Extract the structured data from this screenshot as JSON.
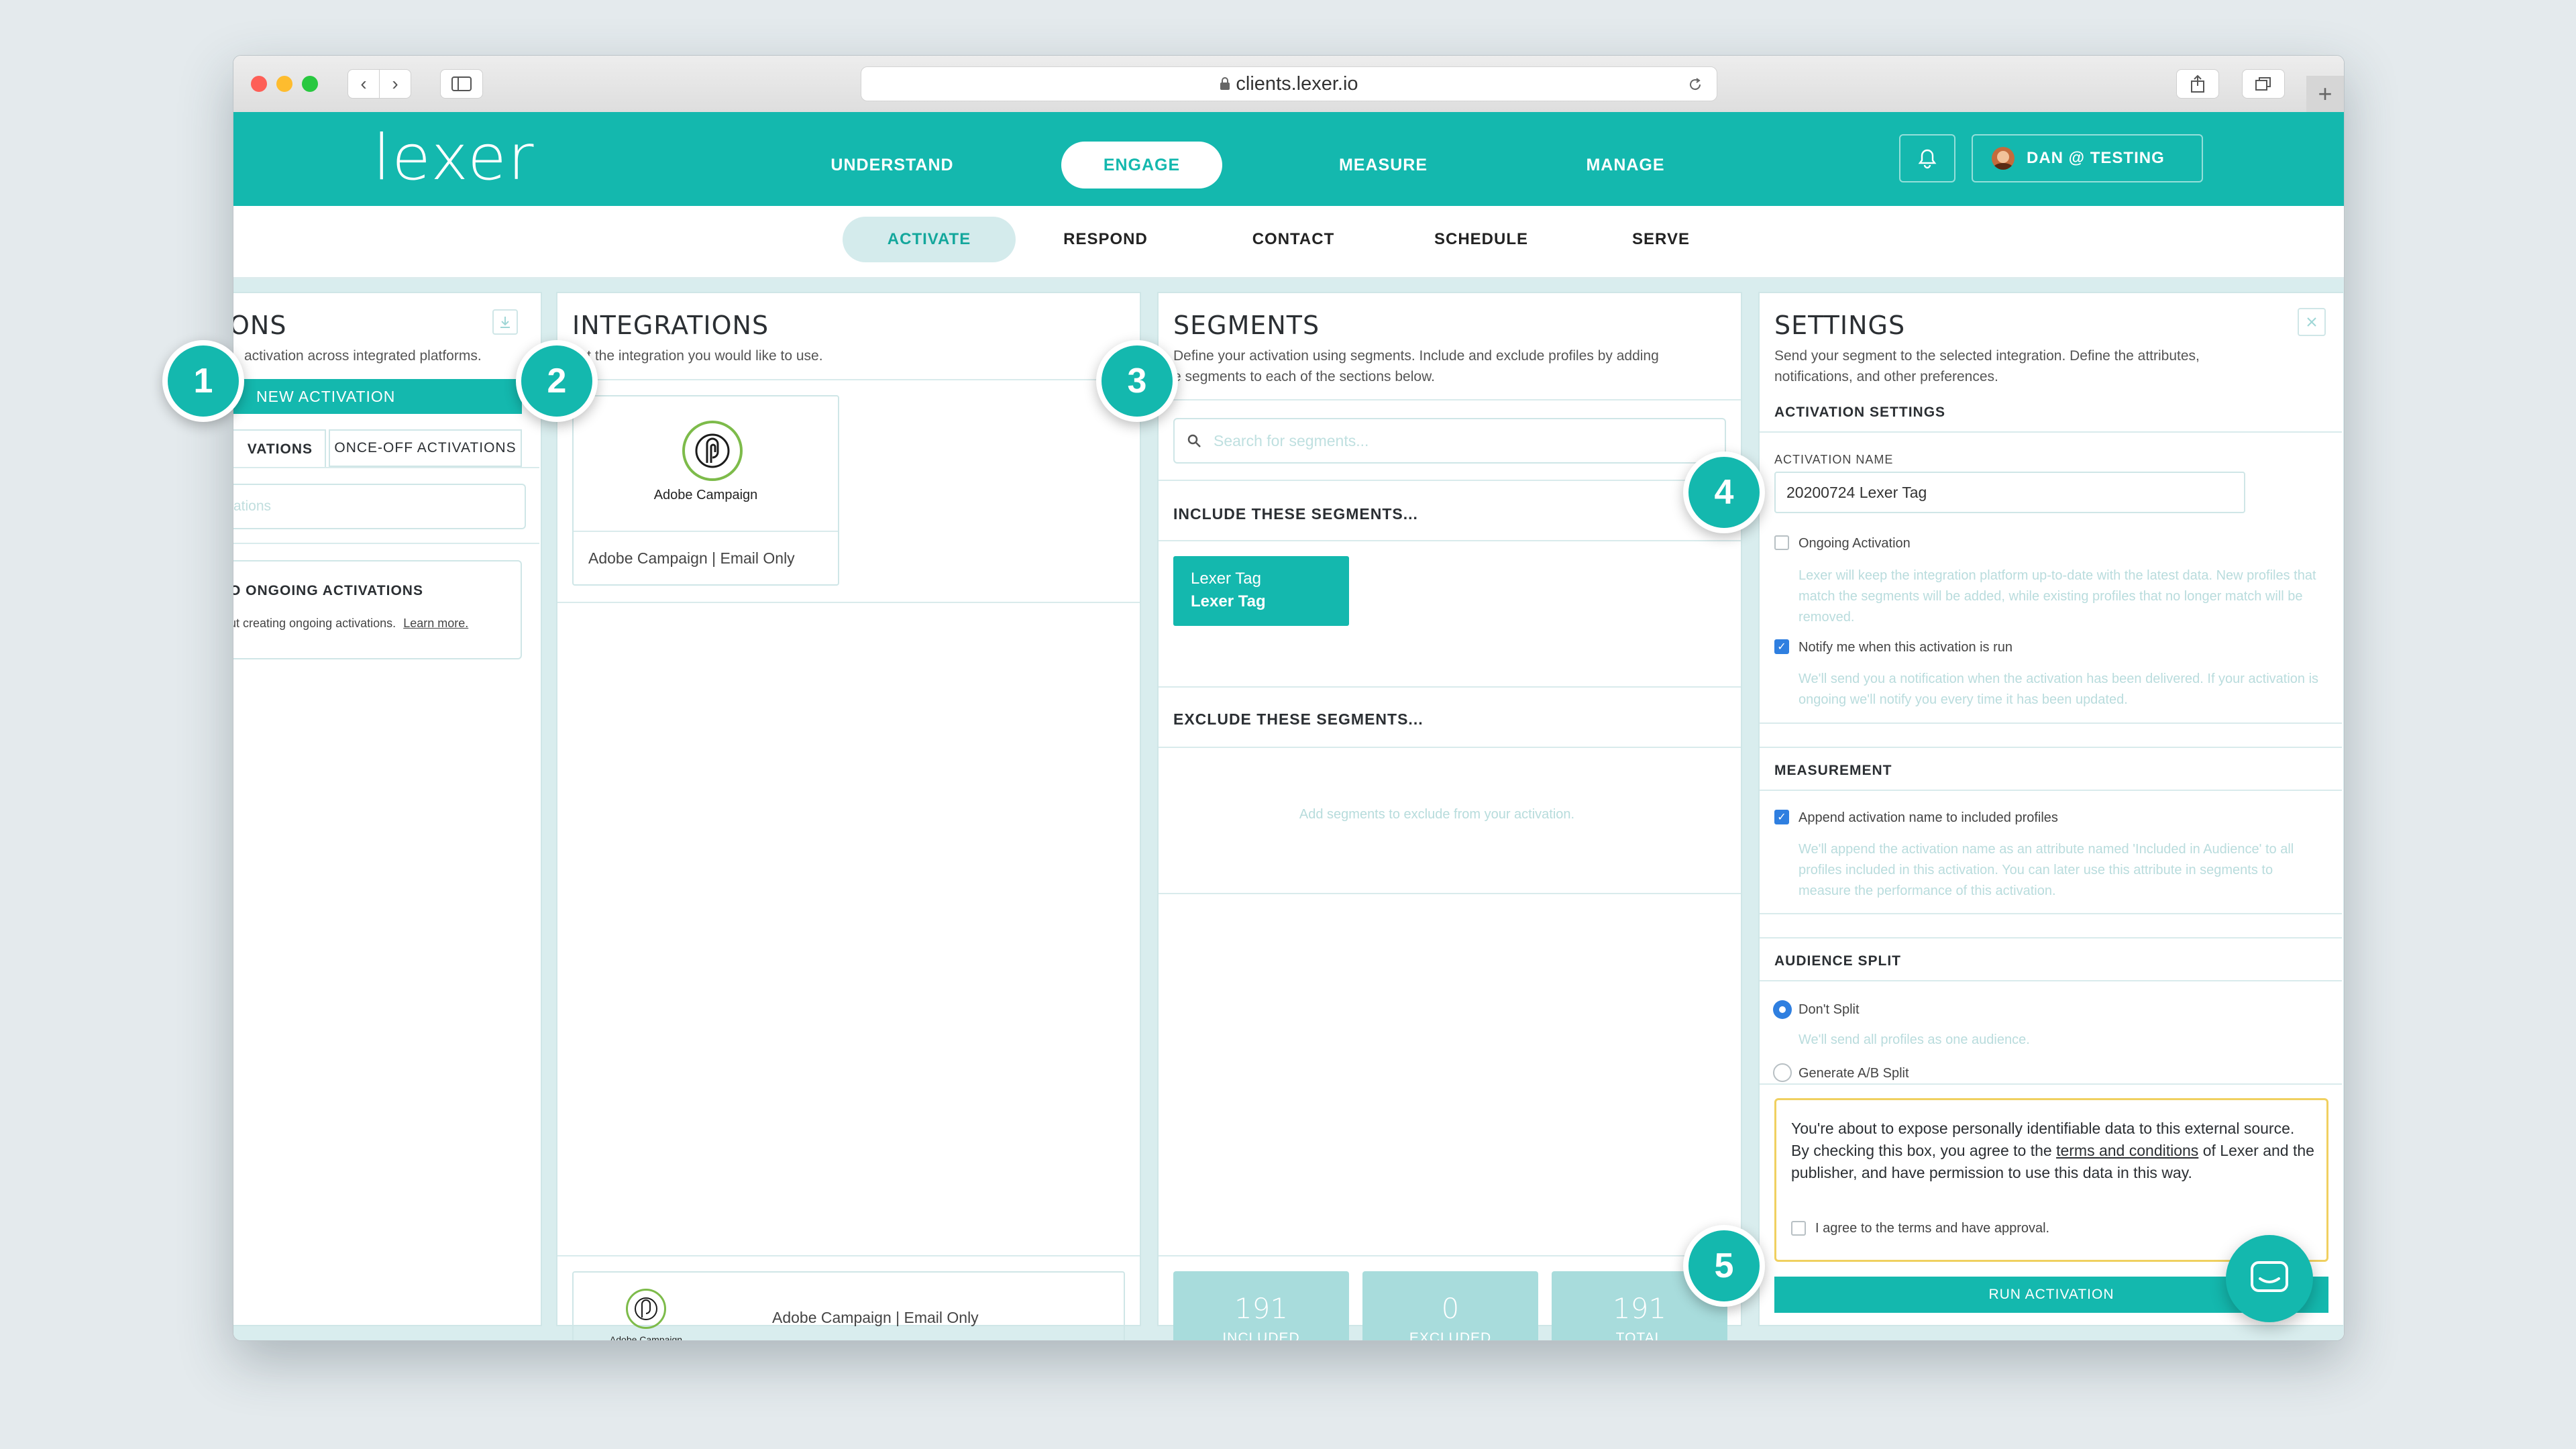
{
  "browser": {
    "url": "clients.lexer.io"
  },
  "brand": {
    "logo": "lexer"
  },
  "nav": {
    "items": [
      "UNDERSTAND",
      "ENGAGE",
      "MEASURE",
      "MANAGE"
    ],
    "active": "ENGAGE"
  },
  "user": {
    "label": "DAN @ TESTING"
  },
  "subnav": {
    "items": [
      "ACTIVATE",
      "RESPOND",
      "CONTACT",
      "SCHEDULE",
      "SERVE"
    ],
    "active": "ACTIVATE"
  },
  "activations": {
    "title": "ONS",
    "desc": "activation across integrated platforms.",
    "new_button": "NEW ACTIVATION",
    "tabs": [
      "VATIONS",
      "ONCE-OFF ACTIVATIONS"
    ],
    "search_placeholder": "ations",
    "empty_title": "O ONGOING ACTIVATIONS",
    "empty_text": "ut creating ongoing activations.",
    "learn_more": "Learn more."
  },
  "integrations": {
    "title": "INTEGRATIONS",
    "desc": "ect the integration you would like to use.",
    "card_logo_text": "Adobe Campaign",
    "card_label": "Adobe Campaign | Email Only",
    "footer_logo_text": "Adobe Campaign",
    "footer_label": "Adobe Campaign | Email Only"
  },
  "segments": {
    "title": "SEGMENTS",
    "desc_line1": "Define your activation using segments. Include and exclude profiles by adding",
    "desc_line2": "e segments to each of the sections below.",
    "search_placeholder": "Search for segments...",
    "include_title": "INCLUDE THESE SEGMENTS...",
    "tag_line1": "Lexer Tag",
    "tag_line2": "Lexer Tag",
    "exclude_title": "EXCLUDE THESE SEGMENTS...",
    "exclude_placeholder": "Add segments to exclude from your activation.",
    "stats": [
      {
        "value": "191",
        "label": "INCLUDED"
      },
      {
        "value": "0",
        "label": "EXCLUDED"
      },
      {
        "value": "191",
        "label": "TOTAL"
      }
    ]
  },
  "settings": {
    "title": "SETTINGS",
    "desc_line1": "Send your segment to the selected integration. Define the attributes,",
    "desc_line2": "notifications, and other preferences.",
    "activation_settings": "ACTIVATION SETTINGS",
    "activation_name_label": "ACTIVATION NAME",
    "activation_name_value": "20200724 Lexer Tag",
    "ongoing_label": "Ongoing Activation",
    "ongoing_checked": false,
    "ongoing_help": "Lexer will keep the integration platform up-to-date with the latest data. New profiles that match the segments will be added, while existing profiles that no longer match will be removed.",
    "notify_label": "Notify me when this activation is run",
    "notify_checked": true,
    "notify_help": "We'll send you a notification when the activation has been delivered. If your activation is ongoing we'll notify you every time it has been updated.",
    "measurement": "MEASUREMENT",
    "append_label": "Append activation name to included profiles",
    "append_checked": true,
    "append_help": "We'll append the activation name as an attribute named 'Included in Audience' to all profiles included in this activation. You can later use this attribute in segments to measure the performance of this activation.",
    "audience_split": "AUDIENCE SPLIT",
    "dont_split": "Don't Split",
    "dont_split_help": "We'll send all profiles as one audience.",
    "ab_split": "Generate A/B Split",
    "warning_pre": "You're about to expose personally identifiable data to this external source. By checking this box, you agree to the",
    "warning_link": "terms and conditions",
    "warning_post": "of Lexer and the publisher, and have permission to use this data in this way.",
    "agree_label": "I agree to the terms and have approval.",
    "run_button": "RUN ACTIVATION"
  },
  "callouts": [
    "1",
    "2",
    "3",
    "4",
    "5"
  ],
  "colors": {
    "accent": "#14b8ae",
    "accent_light": "#a8dcdc",
    "checkbox": "#2f7fe0",
    "warning_border": "#f0d060"
  }
}
